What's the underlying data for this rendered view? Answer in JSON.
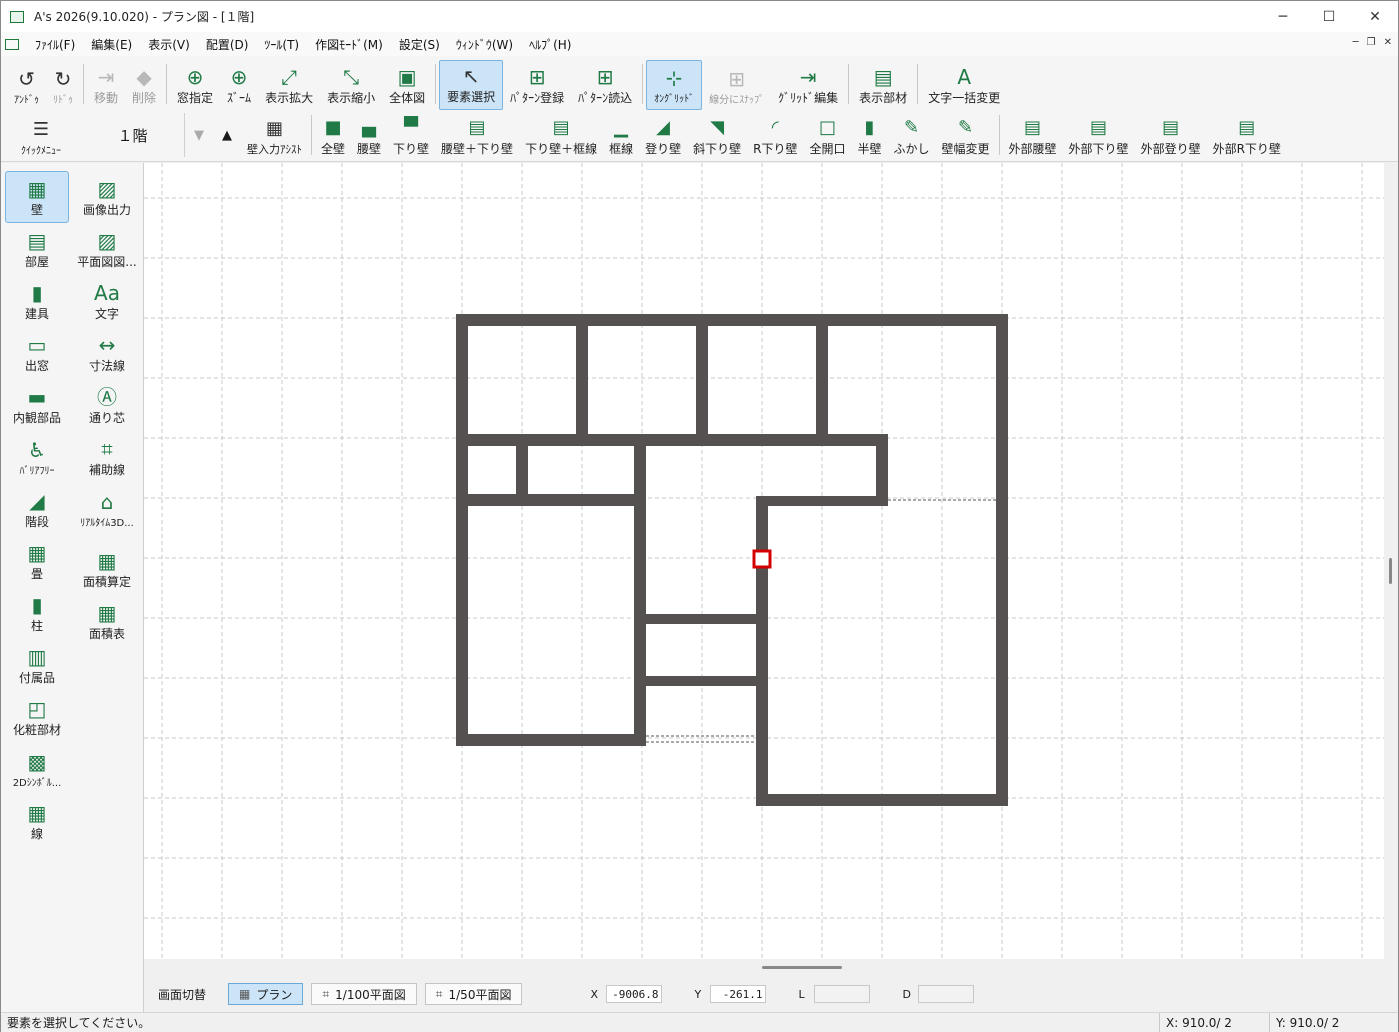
{
  "window": {
    "title": "A's 2026(9.10.020) - プラン図 - [１階]",
    "minimize": "─",
    "maximize": "☐",
    "close": "✕"
  },
  "menu": [
    "ﾌｧｲﾙ(F)",
    "編集(E)",
    "表示(V)",
    "配置(D)",
    "ﾂｰﾙ(T)",
    "作図ﾓｰﾄﾞ(M)",
    "設定(S)",
    "ｳｨﾝﾄﾞｳ(W)",
    "ﾍﾙﾌﾟ(H)"
  ],
  "toolbar1": [
    {
      "label": "ｱﾝﾄﾞｩ",
      "icon": "undo-icon",
      "glyph": "↺"
    },
    {
      "label": "ﾘﾄﾞｩ",
      "icon": "redo-icon",
      "glyph": "↻"
    },
    {
      "label": "移動",
      "icon": "move-icon",
      "glyph": "⇥"
    },
    {
      "label": "削除",
      "icon": "eraser-icon",
      "glyph": "◆"
    },
    {
      "label": "窓指定",
      "icon": "window-zoom-icon",
      "glyph": "⊕"
    },
    {
      "label": "ｽﾞｰﾑ",
      "icon": "zoom-icon",
      "glyph": "⊕"
    },
    {
      "label": "表示拡大",
      "icon": "zoom-in-icon",
      "glyph": "⤢"
    },
    {
      "label": "表示縮小",
      "icon": "zoom-out-icon",
      "glyph": "⤡"
    },
    {
      "label": "全体図",
      "icon": "full-view-icon",
      "glyph": "▣"
    },
    {
      "label": "要素選択",
      "icon": "select-arrow-icon",
      "glyph": "↖"
    },
    {
      "label": "ﾊﾟﾀｰﾝ登録",
      "icon": "pattern-register-icon",
      "glyph": "⊞"
    },
    {
      "label": "ﾊﾟﾀｰﾝ読込",
      "icon": "pattern-load-icon",
      "glyph": "⊞"
    },
    {
      "label": "ｵﾝｸﾞﾘｯﾄﾞ",
      "icon": "on-grid-icon",
      "glyph": "⊹"
    },
    {
      "label": "線分にｽﾅｯﾌﾟ",
      "icon": "snap-segment-icon",
      "glyph": "⊞"
    },
    {
      "label": "ｸﾞﾘｯﾄﾞ編集",
      "icon": "grid-edit-icon",
      "glyph": "⇥"
    },
    {
      "label": "表示部材",
      "icon": "display-parts-icon",
      "glyph": "▤"
    },
    {
      "label": "文字一括変更",
      "icon": "text-batch-icon",
      "glyph": "A"
    }
  ],
  "toolbar2": {
    "quick_menu": "ｸｲｯｸﾒﾆｭｰ",
    "floor": "１階",
    "down": "▼",
    "up": "▲",
    "items": [
      {
        "label": "壁入力ｱｼｽﾄ",
        "icon": "wall-assist-icon",
        "glyph": "▦"
      },
      {
        "label": "全壁",
        "icon": "full-wall-icon",
        "glyph": "■"
      },
      {
        "label": "腰壁",
        "icon": "waist-wall-icon",
        "glyph": "▄"
      },
      {
        "label": "下り壁",
        "icon": "hanging-wall-icon",
        "glyph": "▀"
      },
      {
        "label": "腰壁＋下り壁",
        "icon": "waist-hanging-wall-icon",
        "glyph": "▤"
      },
      {
        "label": "下り壁＋框線",
        "icon": "hanging-frame-wall-icon",
        "glyph": "▤"
      },
      {
        "label": "框線",
        "icon": "frame-line-icon",
        "glyph": "▁"
      },
      {
        "label": "登り壁",
        "icon": "rising-wall-icon",
        "glyph": "◢"
      },
      {
        "label": "斜下り壁",
        "icon": "slant-wall-icon",
        "glyph": "◥"
      },
      {
        "label": "R下り壁",
        "icon": "r-wall-icon",
        "glyph": "◜"
      },
      {
        "label": "全開口",
        "icon": "full-opening-icon",
        "glyph": "□"
      },
      {
        "label": "半壁",
        "icon": "half-wall-icon",
        "glyph": "▮"
      },
      {
        "label": "ふかし",
        "icon": "furring-icon",
        "glyph": "✎"
      },
      {
        "label": "壁幅変更",
        "icon": "wall-width-icon",
        "glyph": "✎"
      },
      {
        "label": "外部腰壁",
        "icon": "ext-waist-wall-icon",
        "glyph": "▤"
      },
      {
        "label": "外部下り壁",
        "icon": "ext-hanging-wall-icon",
        "glyph": "▤"
      },
      {
        "label": "外部登り壁",
        "icon": "ext-rising-wall-icon",
        "glyph": "▤"
      },
      {
        "label": "外部R下り壁",
        "icon": "ext-r-wall-icon",
        "glyph": "▤"
      }
    ]
  },
  "sidebar": {
    "left": [
      {
        "label": "壁",
        "icon": "wall-icon",
        "glyph": "▦"
      },
      {
        "label": "部屋",
        "icon": "room-icon",
        "glyph": "▤"
      },
      {
        "label": "建具",
        "icon": "door-icon",
        "glyph": "▮"
      },
      {
        "label": "出窓",
        "icon": "bay-window-icon",
        "glyph": "▭"
      },
      {
        "label": "内観部品",
        "icon": "interior-parts-icon",
        "glyph": "▬"
      },
      {
        "label": "ﾊﾞﾘｱﾌﾘｰ",
        "icon": "barrier-free-icon",
        "glyph": "♿"
      },
      {
        "label": "階段",
        "icon": "stairs-icon",
        "glyph": "◢"
      },
      {
        "label": "畳",
        "icon": "tatami-icon",
        "glyph": "▦"
      },
      {
        "label": "柱",
        "icon": "pillar-icon",
        "glyph": "▮"
      },
      {
        "label": "付属品",
        "icon": "accessory-icon",
        "glyph": "▥"
      },
      {
        "label": "化粧部材",
        "icon": "decorative-parts-icon",
        "glyph": "◰"
      },
      {
        "label": "2Dｼﾝﾎﾞﾙ...",
        "icon": "2d-symbol-icon",
        "glyph": "▩"
      },
      {
        "label": "線",
        "icon": "line-icon",
        "glyph": "▦"
      }
    ],
    "right": [
      {
        "label": "画像出力",
        "icon": "image-output-icon",
        "glyph": "▨"
      },
      {
        "label": "平面図図...",
        "icon": "plan-drawing-icon",
        "glyph": "▨"
      },
      {
        "label": "文字",
        "icon": "text-icon",
        "glyph": "Aa"
      },
      {
        "label": "寸法線",
        "icon": "dimension-line-icon",
        "glyph": "↔"
      },
      {
        "label": "通り芯",
        "icon": "grid-axis-icon",
        "glyph": "Ⓐ"
      },
      {
        "label": "補助線",
        "icon": "aux-line-icon",
        "glyph": "⌗"
      },
      {
        "label": "ﾘｱﾙﾀｲﾑ3D...",
        "icon": "realtime-3d-icon",
        "glyph": "⌂"
      },
      {
        "label": "面積算定",
        "icon": "area-calc-icon",
        "glyph": "▦"
      },
      {
        "label": "面積表",
        "icon": "area-table-icon",
        "glyph": "▦"
      }
    ]
  },
  "bottom": {
    "switch_label": "画面切替",
    "tabs": [
      "プラン",
      "1/100平面図",
      "1/50平面図"
    ],
    "x_label": "X",
    "x_value": "-9006.8",
    "y_label": "Y",
    "y_value": "-261.1",
    "l_label": "L",
    "l_value": "",
    "d_label": "D",
    "d_value": ""
  },
  "status": {
    "message": "要素を選択してください。",
    "x": "X: 910.0/ 2",
    "y": "Y: 910.0/ 2"
  },
  "colors": {
    "wall": "#555150",
    "grid": "#c8c8c8",
    "marker": "#d40000",
    "accent": "#1f7a45"
  }
}
